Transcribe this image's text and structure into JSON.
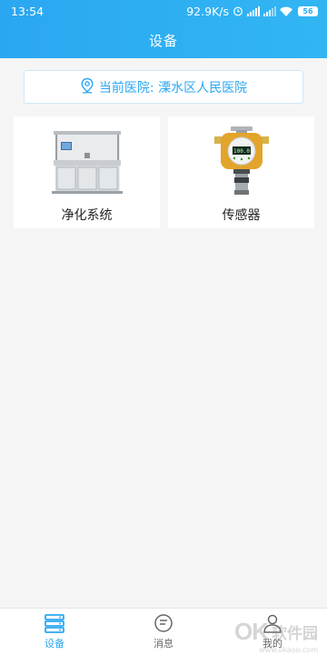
{
  "status_bar": {
    "time": "13:54",
    "network_speed": "92.9K/s",
    "battery_level": "56"
  },
  "header": {
    "title": "设备"
  },
  "hospital": {
    "text": "当前医院: 溧水区人民医院",
    "icon": "location-pin-icon"
  },
  "cards": [
    {
      "label": "净化系统",
      "icon": "purification-system-image"
    },
    {
      "label": "传感器",
      "icon": "sensor-image",
      "display_value": "100.0"
    }
  ],
  "tabbar": {
    "items": [
      {
        "label": "设备",
        "icon": "device-list-icon",
        "active": true
      },
      {
        "label": "消息",
        "icon": "message-icon",
        "active": false
      },
      {
        "label": "我的",
        "icon": "profile-icon",
        "active": false
      }
    ]
  },
  "watermark": {
    "logo": "OK",
    "text": "软件园",
    "url": "www.okaoo.com"
  },
  "colors": {
    "primary": "#2ba7f2",
    "background": "#f5f5f5",
    "card": "#ffffff",
    "text": "#222222"
  }
}
